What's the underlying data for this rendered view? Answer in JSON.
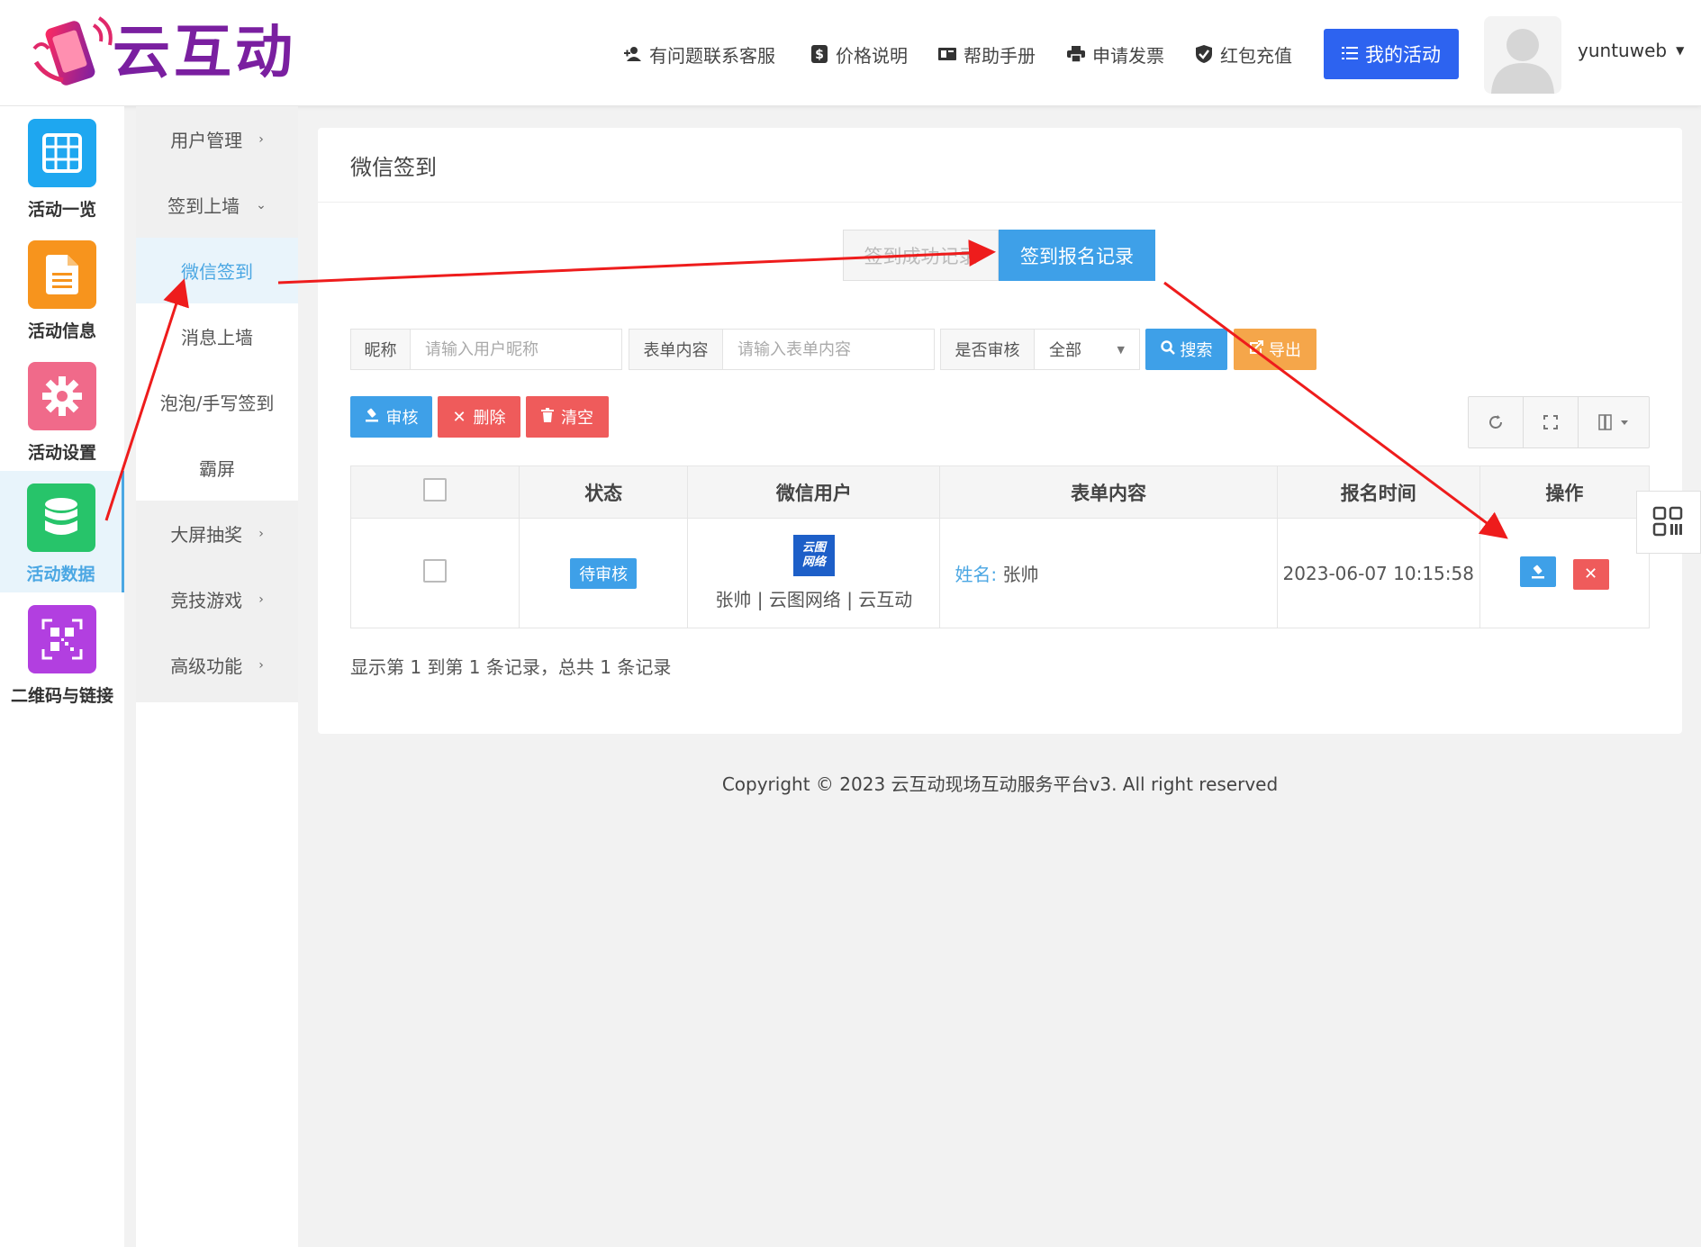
{
  "header": {
    "brand": "云互动",
    "nav": [
      {
        "label": "有问题联系客服",
        "icon": "add-user-icon"
      },
      {
        "label": "价格说明",
        "icon": "dollar-icon"
      },
      {
        "label": "帮助手册",
        "icon": "book-icon"
      },
      {
        "label": "申请发票",
        "icon": "printer-icon"
      },
      {
        "label": "红包充值",
        "icon": "shield-check-icon"
      }
    ],
    "my_activity": "我的活动",
    "username": "yuntuweb"
  },
  "rail": [
    {
      "label": "活动一览",
      "icon": "grid-icon",
      "color": "#1ea7f0"
    },
    {
      "label": "活动信息",
      "icon": "document-icon",
      "color": "#f7941d"
    },
    {
      "label": "活动设置",
      "icon": "gear-icon",
      "color": "#f06a8a"
    },
    {
      "label": "活动数据",
      "icon": "database-icon",
      "color": "#27c46a",
      "active": true
    },
    {
      "label": "二维码与链接",
      "icon": "qrcode-icon",
      "color": "#b23fe0"
    }
  ],
  "submenu": [
    {
      "label": "用户管理",
      "chevron": "›"
    },
    {
      "label": "签到上墙",
      "chevron": "⌄"
    },
    {
      "label": "微信签到",
      "active": true
    },
    {
      "label": "消息上墙"
    },
    {
      "label": "泡泡/手写签到"
    },
    {
      "label": "霸屏"
    },
    {
      "label": "大屏抽奖",
      "chevron": "›"
    },
    {
      "label": "竞技游戏",
      "chevron": "›"
    },
    {
      "label": "高级功能",
      "chevron": "›"
    }
  ],
  "card": {
    "title": "微信签到",
    "tabs": [
      "签到成功记录",
      "签到报名记录"
    ],
    "search": {
      "nickname_label": "昵称",
      "nickname_placeholder": "请输入用户昵称",
      "form_label": "表单内容",
      "form_placeholder": "请输入表单内容",
      "review_label": "是否审核",
      "review_value": "全部",
      "search_button": "搜索",
      "export_button": "导出"
    },
    "actions": {
      "review": "审核",
      "delete": "删除",
      "clear": "清空"
    },
    "table": {
      "headers": [
        "状态",
        "微信用户",
        "表单内容",
        "报名时间",
        "操作"
      ],
      "rows": [
        {
          "status": "待审核",
          "avatar_text": [
            "云图",
            "网络"
          ],
          "user": "张帅 | 云图网络 | 云互动",
          "form_key": "姓名:",
          "form_value": " 张帅",
          "time": "2023-06-07 10:15:58"
        }
      ]
    },
    "pagination": "显示第 1 到第 1 条记录，总共 1 条记录"
  },
  "footer": "Copyright © 2023 云互动现场互动服务平台v3. All right reserved"
}
